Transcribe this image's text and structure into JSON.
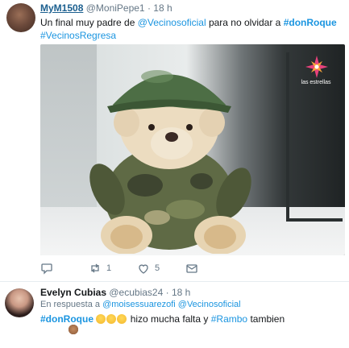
{
  "tweet1": {
    "display_name": "MyM1508",
    "handle": "@MoniPepe1",
    "time": "18 h",
    "text_pre": "Un final muy padre de ",
    "mention": "@Vecinosoficial",
    "text_mid": " para no olvidar a ",
    "hashtag_main": "#donRoque",
    "hashtag_second": "#VecinosRegresa",
    "media_logo_text": "las estrellas",
    "reply_count": "",
    "retweet_count": "1",
    "like_count": "5"
  },
  "tweet2": {
    "display_name": "Evelyn Cubias",
    "handle": "@ecubias24",
    "time": "18 h",
    "reply_prefix": "En respuesta a ",
    "reply_mention_1": "@moisessuarezofi",
    "reply_mention_2": "@Vecinosoficial",
    "hashtag_1": "#donRoque",
    "text_mid": " hizo mucha falta y ",
    "hashtag_2": "#Rambo",
    "text_end": " tambien "
  },
  "colors": {
    "link": "#1b95e0",
    "muted": "#657786",
    "text": "#14171a"
  },
  "icons": [
    "reply-icon",
    "retweet-icon",
    "like-icon",
    "message-icon"
  ]
}
